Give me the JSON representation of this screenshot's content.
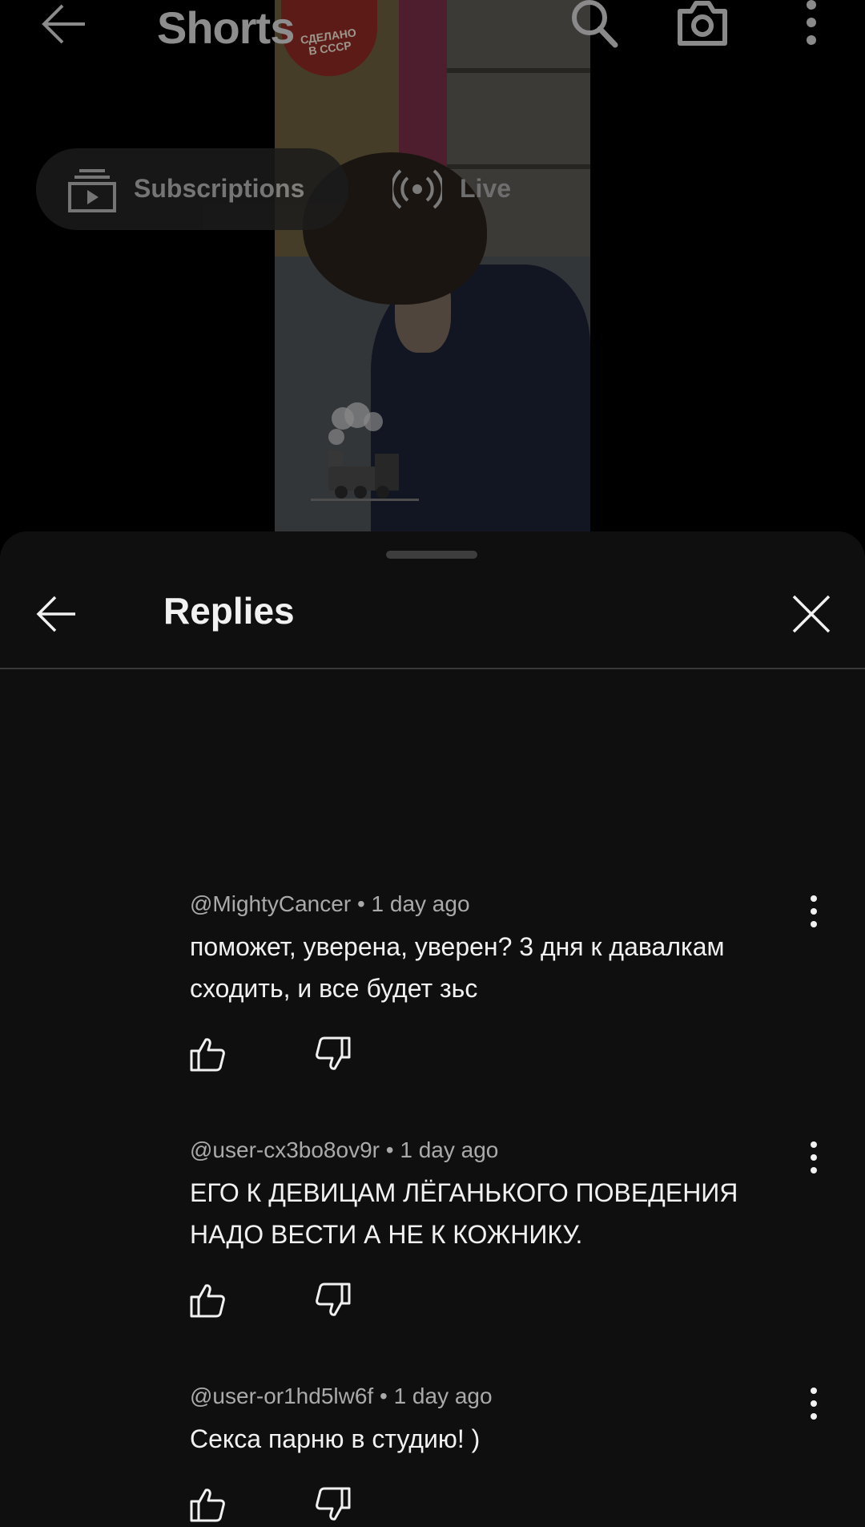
{
  "shorts_header": {
    "title": "Shorts",
    "icons": [
      "back-arrow-icon",
      "search-icon",
      "camera-icon",
      "more-vert-icon"
    ]
  },
  "chips": {
    "subscriptions_label": "Subscriptions",
    "live_label": "Live"
  },
  "video": {
    "logo_text_1": "СДЕЛАНО",
    "logo_text_2": "В СССР"
  },
  "sheet": {
    "title": "Replies",
    "icons": [
      "back-arrow-icon",
      "close-icon"
    ]
  },
  "replies": [
    {
      "author": "@MightyCancer",
      "time": "1 day ago",
      "text": "поможет, уверена, уверен? 3 дня к давалкам сходить, и все будет зьс"
    },
    {
      "author": "@user-cx3bo8ov9r",
      "time": "1 day ago",
      "text": "ЕГО К ДЕВИЦАМ ЛЁГАНЬКОГО ПОВЕДЕНИЯ НАДО ВЕСТИ А НЕ К КОЖНИКУ."
    },
    {
      "author": "@user-or1hd5lw6f",
      "time": "1 day ago",
      "text": "Секса парню в студию! )"
    }
  ],
  "colors": {
    "background": "#0f0f0f",
    "text_primary": "#f1f1f1",
    "text_secondary": "#aaaaaa"
  }
}
